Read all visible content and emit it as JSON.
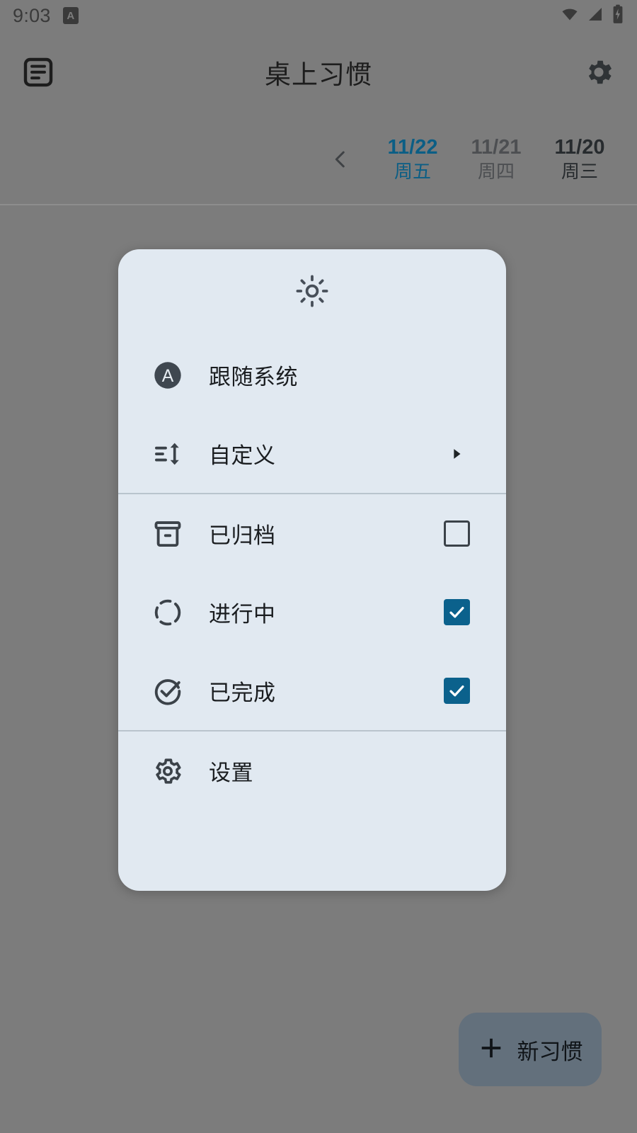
{
  "status_bar": {
    "clock": "9:03",
    "badge_letter": "A",
    "icons": [
      "wifi-icon",
      "cell-signal-icon",
      "battery-charging-icon"
    ]
  },
  "app_bar": {
    "title": "桌上习惯",
    "left_icon": "summary-list-icon",
    "right_icon": "gear-icon"
  },
  "date_strip": {
    "prev_icon": "chevron-left-icon",
    "dates": [
      {
        "date": "11/22",
        "weekday": "周五",
        "state": "selected"
      },
      {
        "date": "11/21",
        "weekday": "周四",
        "state": "muted"
      },
      {
        "date": "11/20",
        "weekday": "周三",
        "state": "normal"
      }
    ]
  },
  "fab": {
    "icon": "plus-icon",
    "label": "新习惯"
  },
  "dialog": {
    "header_icon": "brightness-sun-icon",
    "sections": [
      {
        "items": [
          {
            "icon": "circle-a-auto-icon",
            "label": "跟随系统",
            "trailing": "none"
          },
          {
            "icon": "sort-icon",
            "label": "自定义",
            "trailing": "submenu-arrow"
          }
        ]
      },
      {
        "items": [
          {
            "icon": "archive-icon",
            "label": "已归档",
            "trailing": "checkbox",
            "checked": false
          },
          {
            "icon": "dashed-circle-icon",
            "label": "进行中",
            "trailing": "checkbox",
            "checked": true
          },
          {
            "icon": "check-circle-icon",
            "label": "已完成",
            "trailing": "checkbox",
            "checked": true
          }
        ]
      },
      {
        "items": [
          {
            "icon": "gear-icon",
            "label": "设置",
            "trailing": "none"
          }
        ]
      }
    ]
  },
  "colors": {
    "scrim": "#7c7c7c",
    "dialog_bg": "#e1e9f1",
    "accent": "#0b618c",
    "selected_date": "#0b5e85",
    "icon_dark": "#3b4249",
    "fab_bg": "#63707c"
  }
}
